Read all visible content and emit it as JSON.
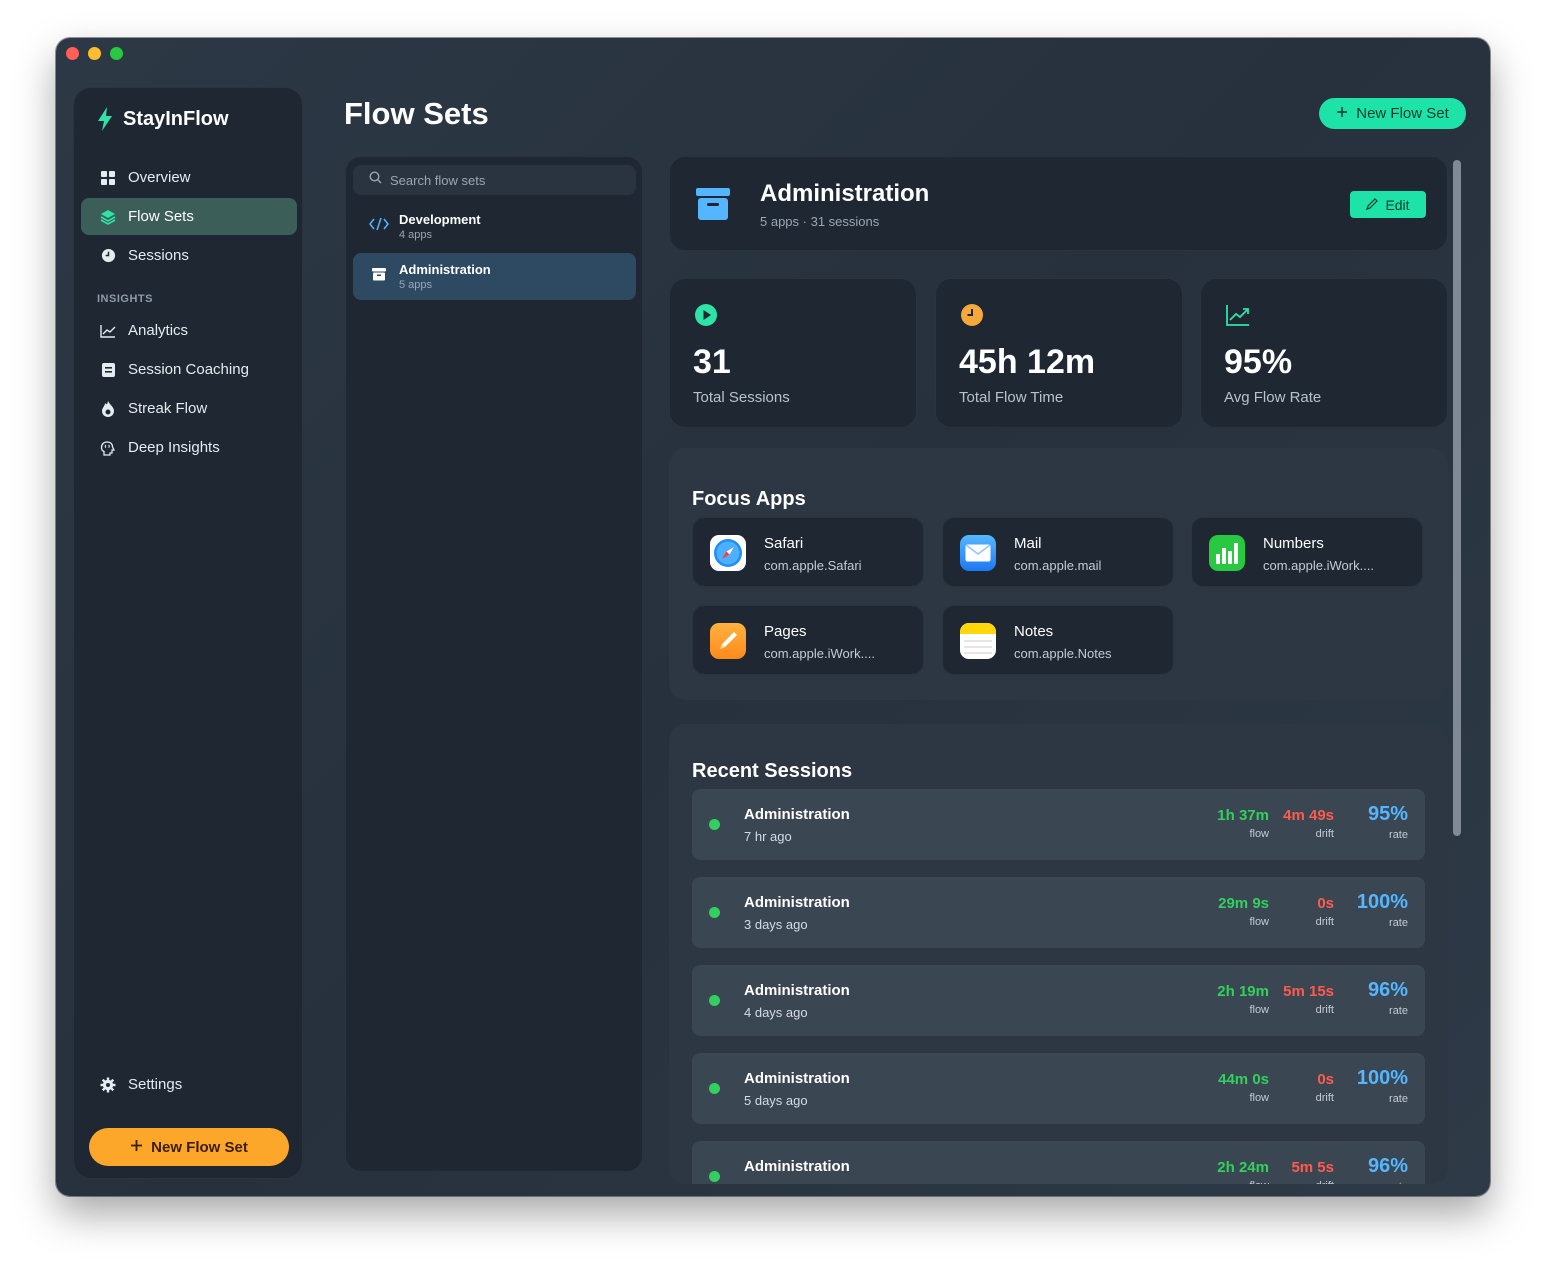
{
  "app": {
    "name": "StayInFlow"
  },
  "nav": {
    "items": [
      {
        "label": "Overview",
        "icon": "grid-icon"
      },
      {
        "label": "Flow Sets",
        "icon": "layers-icon",
        "active": true
      },
      {
        "label": "Sessions",
        "icon": "clock-icon"
      }
    ],
    "section_label": "INSIGHTS",
    "insights": [
      {
        "label": "Analytics",
        "icon": "chart-icon"
      },
      {
        "label": "Session Coaching",
        "icon": "clipboard-icon"
      },
      {
        "label": "Streak Flow",
        "icon": "flame-icon"
      },
      {
        "label": "Deep Insights",
        "icon": "brain-icon"
      }
    ],
    "settings_label": "Settings",
    "new_button_label": "New Flow Set"
  },
  "page": {
    "title": "Flow Sets",
    "new_button_label": "New Flow Set"
  },
  "list": {
    "search_placeholder": "Search flow sets",
    "items": [
      {
        "name": "Development",
        "sub": "4 apps",
        "icon": "code-icon"
      },
      {
        "name": "Administration",
        "sub": "5 apps",
        "icon": "archive-icon",
        "active": true
      }
    ]
  },
  "detail": {
    "title": "Administration",
    "subtitle": "5 apps · 31 sessions",
    "edit_label": "Edit",
    "stats": [
      {
        "value": "31",
        "label": "Total Sessions",
        "icon": "play-icon",
        "color": "#2ee3a5"
      },
      {
        "value": "45h 12m",
        "label": "Total Flow Time",
        "icon": "clock-icon",
        "color": "#f5a93b"
      },
      {
        "value": "95%",
        "label": "Avg Flow Rate",
        "icon": "trend-up-icon",
        "color": "#2ee3a5"
      }
    ],
    "focus_title": "Focus Apps",
    "apps": [
      {
        "name": "Safari",
        "bundle": "com.apple.Safari",
        "icon": "safari-icon"
      },
      {
        "name": "Mail",
        "bundle": "com.apple.mail",
        "icon": "mail-icon"
      },
      {
        "name": "Numbers",
        "bundle": "com.apple.iWork....",
        "icon": "numbers-icon"
      },
      {
        "name": "Pages",
        "bundle": "com.apple.iWork....",
        "icon": "pages-icon"
      },
      {
        "name": "Notes",
        "bundle": "com.apple.Notes",
        "icon": "notes-icon"
      }
    ],
    "recent_title": "Recent Sessions",
    "metric_labels": {
      "flow": "flow",
      "drift": "drift",
      "rate": "rate"
    },
    "sessions": [
      {
        "name": "Administration",
        "time": "7 hr ago",
        "flow": "1h 37m",
        "drift": "4m 49s",
        "rate": "95%"
      },
      {
        "name": "Administration",
        "time": "3 days ago",
        "flow": "29m 9s",
        "drift": "0s",
        "rate": "100%"
      },
      {
        "name": "Administration",
        "time": "4 days ago",
        "flow": "2h 19m",
        "drift": "5m 15s",
        "rate": "96%"
      },
      {
        "name": "Administration",
        "time": "5 days ago",
        "flow": "44m 0s",
        "drift": "0s",
        "rate": "100%"
      },
      {
        "name": "Administration",
        "time": "",
        "flow": "2h 24m",
        "drift": "5m 5s",
        "rate": "96%"
      }
    ]
  },
  "colors": {
    "accent_green": "#1ee3a8",
    "accent_orange": "#fca62a",
    "flow_green": "#32d05e",
    "drift_red": "#ff5b4c",
    "rate_blue": "#54b6ff"
  }
}
